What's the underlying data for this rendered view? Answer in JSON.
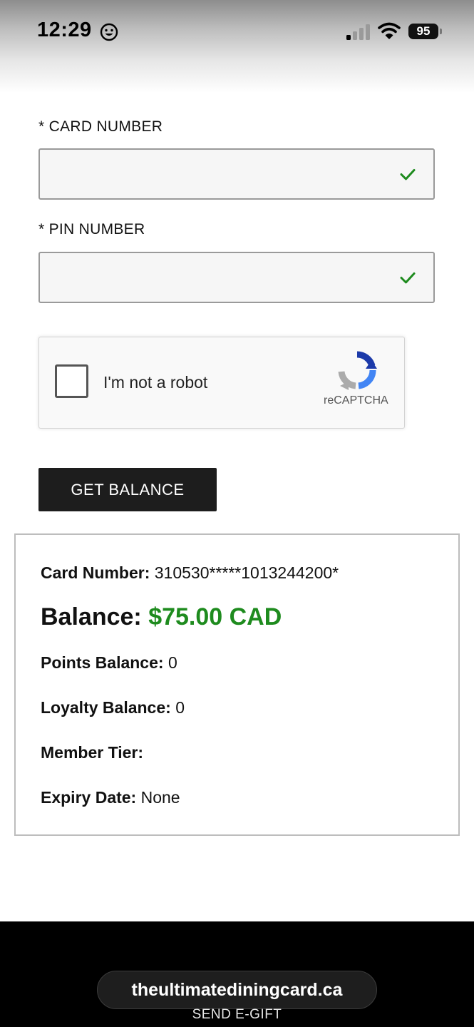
{
  "status_bar": {
    "time": "12:29",
    "battery": "95"
  },
  "form": {
    "card_number_label": "* CARD NUMBER",
    "card_number_value": "",
    "pin_number_label": "* PIN NUMBER",
    "pin_number_value": ""
  },
  "recaptcha": {
    "label": "I'm not a robot",
    "brand": "reCAPTCHA"
  },
  "button": {
    "get_balance_label": "GET BALANCE"
  },
  "result": {
    "card_number_label": "Card Number:",
    "card_number_value": "310530*****1013244200*",
    "balance_label": "Balance:",
    "balance_value": "$75.00 CAD",
    "points_label": "Points Balance:",
    "points_value": "0",
    "loyalty_label": "Loyalty Balance:",
    "loyalty_value": "0",
    "tier_label": "Member Tier:",
    "tier_value": "",
    "expiry_label": "Expiry Date:",
    "expiry_value": "None"
  },
  "footer": {
    "url": "theultimatediningcard.ca",
    "send_egift": "SEND E-GIFT"
  },
  "colors": {
    "balance_green": "#1e8b1e",
    "check_green": "#1e8b1e",
    "button_bg": "#1d1d1d"
  },
  "icons": {
    "status_face": "smiley-icon",
    "signal": "cellular-signal-icon",
    "wifi": "wifi-icon",
    "field_valid": "checkmark-icon",
    "recaptcha": "recaptcha-logo-icon"
  }
}
